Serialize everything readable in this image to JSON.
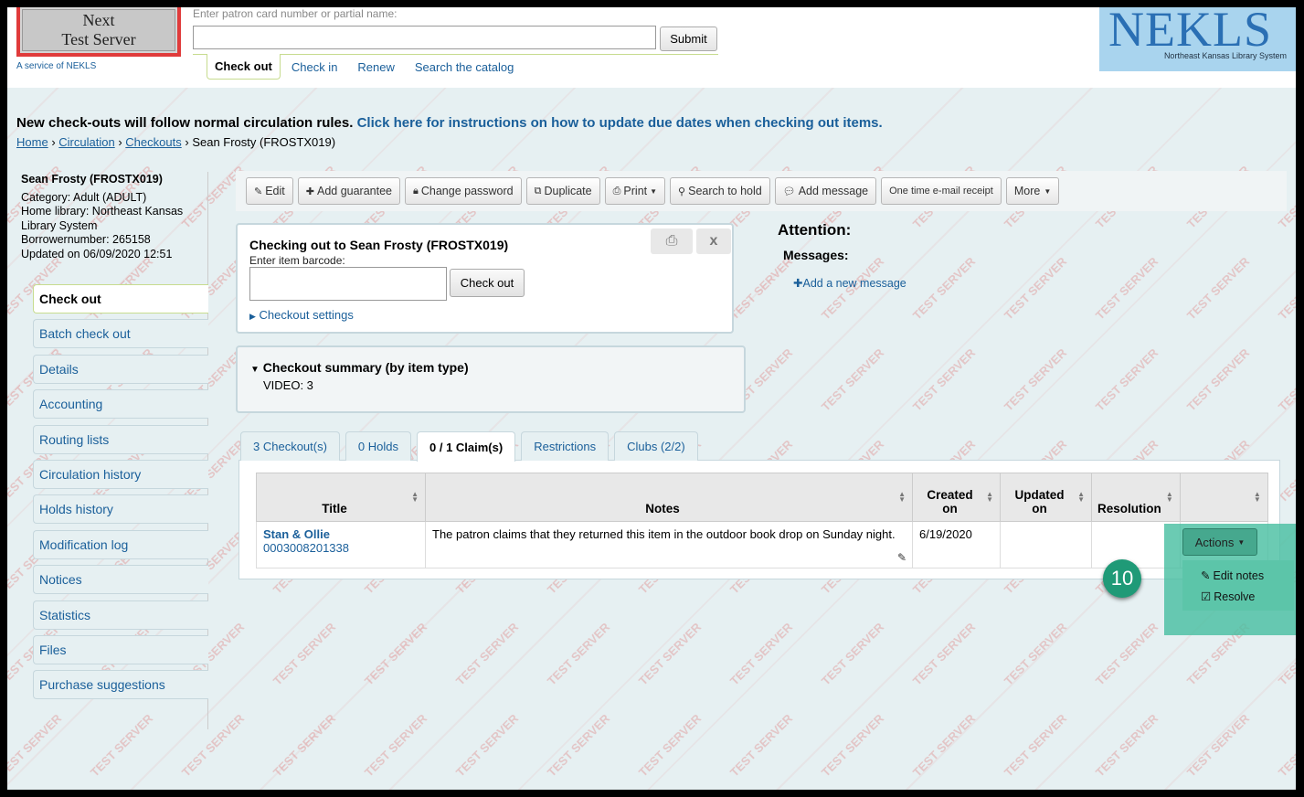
{
  "header": {
    "logo_line1": "Next",
    "logo_line2": "Test Server",
    "service_text": "A service of NEKLS",
    "search_label": "Enter patron card number or partial name:",
    "submit_label": "Submit",
    "tabs": [
      "Check out",
      "Check in",
      "Renew",
      "Search the catalog"
    ],
    "brand_big": "NEKLS",
    "brand_small": "Northeast Kansas Library System"
  },
  "notice": {
    "text": "New check-outs will follow normal circulation rules.",
    "link": "Click here for instructions on how to update due dates when checking out items."
  },
  "breadcrumb": {
    "home": "Home",
    "circulation": "Circulation",
    "checkouts": "Checkouts",
    "current": "Sean Frosty (FROSTX019)"
  },
  "patron": {
    "name": "Sean Frosty (FROSTX019)",
    "category": "Category: Adult (ADULT)",
    "home_library_1": "Home library: Northeast Kansas",
    "home_library_2": "Library System",
    "borrowernumber": "Borrowernumber: 265158",
    "updated": "Updated on 06/09/2020 12:51"
  },
  "sidebar": {
    "items": [
      "Check out",
      "Batch check out",
      "Details",
      "Accounting",
      "Routing lists",
      "Circulation history",
      "Holds history",
      "Modification log",
      "Notices",
      "Statistics",
      "Files",
      "Purchase suggestions"
    ]
  },
  "toolbar": {
    "edit": "Edit",
    "add_guarantee": "Add guarantee",
    "change_password": "Change password",
    "duplicate": "Duplicate",
    "print": "Print",
    "search_to_hold": "Search to hold",
    "add_message": "Add message",
    "email_receipt": "One time e-mail receipt",
    "more": "More"
  },
  "checkout": {
    "title": "Checking out to Sean Frosty (FROSTX019)",
    "barcode_label": "Enter item barcode:",
    "button": "Check out",
    "settings": "Checkout settings",
    "close": "x"
  },
  "summary": {
    "title": "Checkout summary (by item type)",
    "video": "VIDEO: 3"
  },
  "attention": {
    "title": "Attention:",
    "messages": "Messages:",
    "add_message": "Add a new message"
  },
  "tabs": [
    "3 Checkout(s)",
    "0 Holds",
    "0 / 1 Claim(s)",
    "Restrictions",
    "Clubs (2/2)"
  ],
  "claims_table": {
    "headers": {
      "title": "Title",
      "notes": "Notes",
      "created_1": "Created",
      "created_2": "on",
      "updated_1": "Updated",
      "updated_2": "on",
      "resolution": "Resolution"
    },
    "row": {
      "title": "Stan & Ollie",
      "barcode": "0003008201338",
      "notes": "The patron claims that they returned this item in the outdoor book drop on Sunday night.",
      "created": "6/19/2020",
      "updated": "",
      "resolution": ""
    }
  },
  "actions": {
    "button": "Actions",
    "items": [
      "Edit notes",
      "Resolve"
    ]
  },
  "step_badge": "10",
  "watermark_text": "TEST SERVER"
}
